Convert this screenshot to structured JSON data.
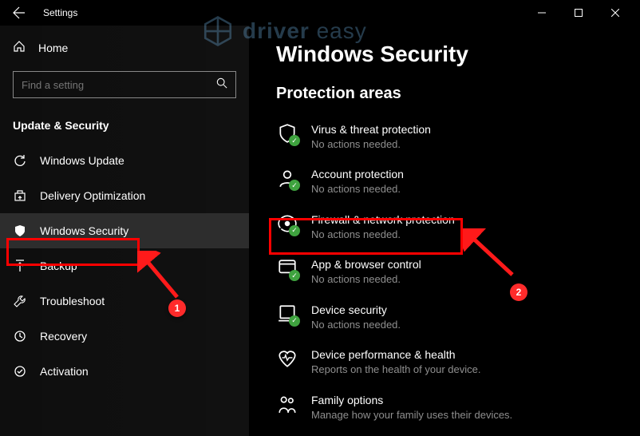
{
  "titlebar": {
    "title": "Settings"
  },
  "sidebar": {
    "home_label": "Home",
    "search_placeholder": "Find a setting",
    "section_label": "Update & Security",
    "items": [
      {
        "label": "Windows Update"
      },
      {
        "label": "Delivery Optimization"
      },
      {
        "label": "Windows Security",
        "selected": true
      },
      {
        "label": "Backup"
      },
      {
        "label": "Troubleshoot"
      },
      {
        "label": "Recovery"
      },
      {
        "label": "Activation"
      }
    ]
  },
  "main": {
    "heading": "Windows Security",
    "subheading": "Protection areas",
    "areas": [
      {
        "title": "Virus & threat protection",
        "sub": "No actions needed."
      },
      {
        "title": "Account protection",
        "sub": "No actions needed."
      },
      {
        "title": "Firewall & network protection",
        "sub": "No actions needed."
      },
      {
        "title": "App & browser control",
        "sub": "No actions needed."
      },
      {
        "title": "Device security",
        "sub": "No actions needed."
      },
      {
        "title": "Device performance & health",
        "sub": "Reports on the health of your device."
      },
      {
        "title": "Family options",
        "sub": "Manage how your family uses their devices."
      }
    ]
  },
  "annotations": {
    "badge1": "1",
    "badge2": "2"
  },
  "watermark": {
    "brand_bold": "driver",
    "brand_rest": " easy"
  }
}
